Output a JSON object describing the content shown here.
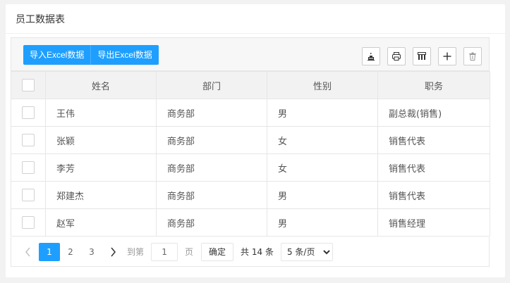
{
  "panel": {
    "title": "员工数据表"
  },
  "toolbar": {
    "import_label": "导入Excel数据",
    "export_label": "导出Excel数据",
    "icons": [
      "cake-icon",
      "print-icon",
      "columns-icon",
      "plus-icon",
      "trash-icon"
    ]
  },
  "table": {
    "headers": [
      "姓名",
      "部门",
      "性别",
      "职务"
    ],
    "rows": [
      [
        "王伟",
        "商务部",
        "男",
        "副总裁(销售)"
      ],
      [
        "张颖",
        "商务部",
        "女",
        "销售代表"
      ],
      [
        "李芳",
        "商务部",
        "女",
        "销售代表"
      ],
      [
        "郑建杰",
        "商务部",
        "男",
        "销售代表"
      ],
      [
        "赵军",
        "商务部",
        "男",
        "销售经理"
      ]
    ]
  },
  "pager": {
    "pages": [
      "1",
      "2",
      "3"
    ],
    "current": "1",
    "goto_label": "到第",
    "page_label": "页",
    "goto_value": "1",
    "confirm_label": "确定",
    "total_label": "共 14 条",
    "page_size": "5 条/页"
  },
  "colors": {
    "primary": "#1e9fff",
    "header_bg": "#f2f2f2",
    "border": "#e6e6e6"
  }
}
